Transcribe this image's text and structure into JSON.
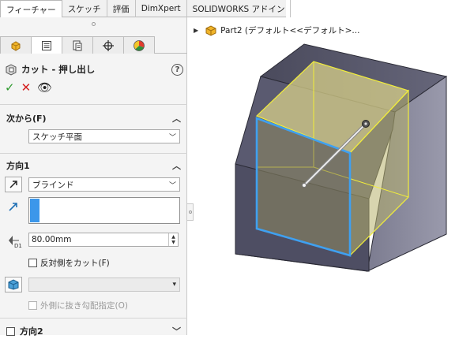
{
  "top_tabs": [
    "フィーチャー",
    "スケッチ",
    "評価",
    "DimXpert",
    "SOLIDWORKS アドイン"
  ],
  "panel": {
    "tabs": [
      "feature-manager-icon",
      "property-manager-icon",
      "configuration-manager-icon",
      "dimxpert-manager-icon",
      "display-manager-icon"
    ],
    "feature_title": "カット - 押し出し",
    "help": "?",
    "ok": "✓",
    "cancel": "✕",
    "preview": "👁",
    "from_section": {
      "title": "次から(F)",
      "value": "スケッチ平面"
    },
    "direction1": {
      "title": "方向1",
      "end_condition": "ブラインド",
      "depth": "80.00mm",
      "flip_side_label": "反対側をカット(F)",
      "draft_label": "外側に抜き勾配指定(O)"
    },
    "direction2": {
      "title": "方向2"
    }
  },
  "viewport": {
    "tree_label": "Part2 (デフォルト<<デフォルト>..."
  },
  "colors": {
    "accent_blue": "#3c97ea",
    "ok_green": "#2e9a2e",
    "cancel_red": "#d42020",
    "sketch_blue": "#3fa0f0",
    "preview_yellow": "#f2ee3a"
  }
}
